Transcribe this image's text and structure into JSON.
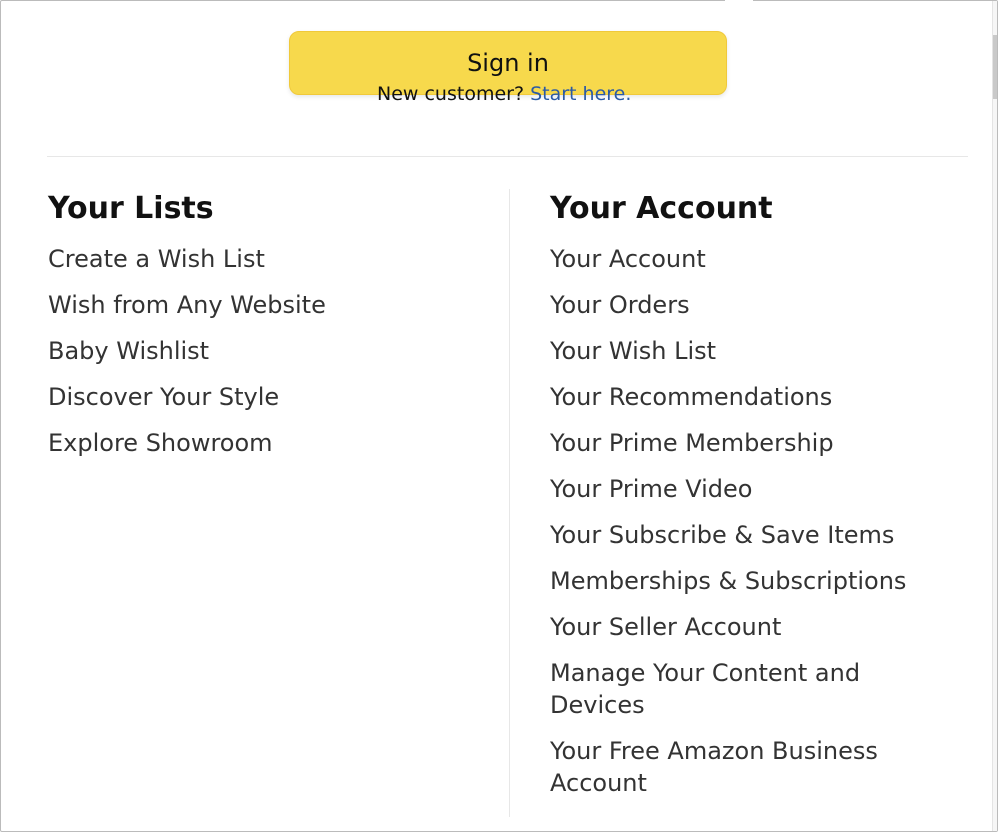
{
  "signin": {
    "button_label": "Sign in",
    "new_customer_prefix": "New customer?",
    "start_here_label": "Start here."
  },
  "lists": {
    "title": "Your Lists",
    "items": [
      {
        "label": "Create a Wish List"
      },
      {
        "label": "Wish from Any Website"
      },
      {
        "label": "Baby Wishlist"
      },
      {
        "label": "Discover Your Style"
      },
      {
        "label": "Explore Showroom"
      }
    ]
  },
  "account": {
    "title": "Your Account",
    "items": [
      {
        "label": "Your Account"
      },
      {
        "label": "Your Orders"
      },
      {
        "label": "Your Wish List"
      },
      {
        "label": "Your Recommendations"
      },
      {
        "label": "Your Prime Membership"
      },
      {
        "label": "Your Prime Video"
      },
      {
        "label": "Your Subscribe & Save Items"
      },
      {
        "label": "Memberships & Subscriptions"
      },
      {
        "label": "Your Seller Account"
      },
      {
        "label": "Manage Your Content and Devices"
      },
      {
        "label": "Your Free Amazon Business Account"
      }
    ]
  },
  "colors": {
    "signin_button": "#f7d94c",
    "link": "#2a5aa6",
    "text": "#333333"
  }
}
